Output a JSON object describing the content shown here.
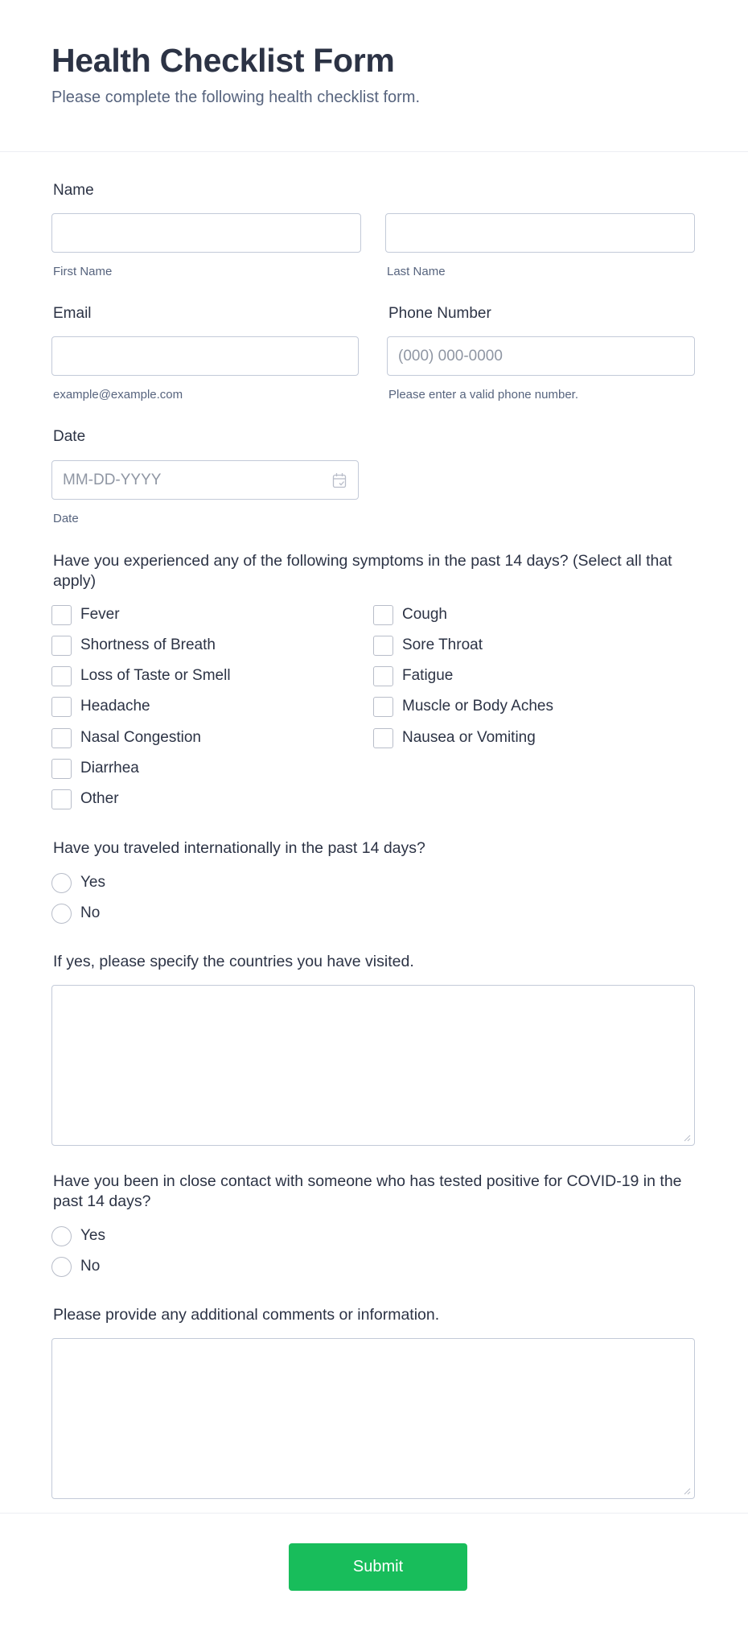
{
  "header": {
    "title": "Health Checklist Form",
    "subtitle": "Please complete the following health checklist form."
  },
  "name": {
    "label": "Name",
    "first_value": "",
    "first_sublabel": "First Name",
    "last_value": "",
    "last_sublabel": "Last Name"
  },
  "email": {
    "label": "Email",
    "value": "",
    "sublabel": "example@example.com"
  },
  "phone": {
    "label": "Phone Number",
    "placeholder": "(000) 000-0000",
    "sublabel": "Please enter a valid phone number."
  },
  "date": {
    "label": "Date",
    "placeholder": "MM-DD-YYYY",
    "sublabel": "Date",
    "icon": "calendar-icon"
  },
  "symptoms": {
    "question": "Have you experienced any of the following symptoms in the past 14 days? (Select all that apply)",
    "options": [
      {
        "label": "Fever",
        "checked": false
      },
      {
        "label": "Cough",
        "checked": false
      },
      {
        "label": "Shortness of Breath",
        "checked": false
      },
      {
        "label": "Sore Throat",
        "checked": false
      },
      {
        "label": "Loss of Taste or Smell",
        "checked": false
      },
      {
        "label": "Fatigue",
        "checked": false
      },
      {
        "label": "Headache",
        "checked": false
      },
      {
        "label": "Muscle or Body Aches",
        "checked": false
      },
      {
        "label": "Nasal Congestion",
        "checked": false
      },
      {
        "label": "Nausea or Vomiting",
        "checked": false
      },
      {
        "label": "Diarrhea",
        "checked": false
      },
      {
        "label": "Other",
        "checked": false
      }
    ]
  },
  "travel": {
    "question": "Have you traveled internationally in the past 14 days?",
    "options": [
      {
        "label": "Yes",
        "selected": false
      },
      {
        "label": "No",
        "selected": false
      }
    ]
  },
  "countries": {
    "label": "If yes, please specify the countries you have visited.",
    "value": ""
  },
  "contact": {
    "question": "Have you been in close contact with someone who has tested positive for COVID-19 in the past 14 days?",
    "options": [
      {
        "label": "Yes",
        "selected": false
      },
      {
        "label": "No",
        "selected": false
      }
    ]
  },
  "comments": {
    "label": "Please provide any additional comments or information.",
    "value": ""
  },
  "submit": {
    "label": "Submit",
    "color": "#18bd5b"
  }
}
